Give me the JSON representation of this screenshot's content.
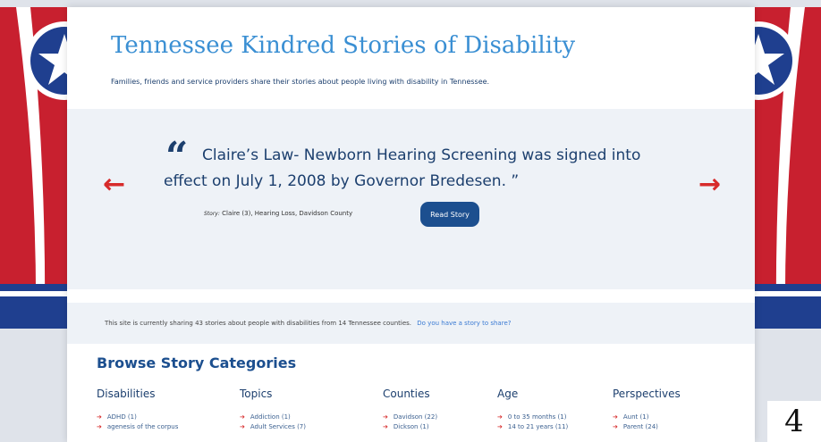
{
  "site": {
    "title": "Tennessee Kindred Stories of Disability",
    "tagline": "Families, friends and service providers share their stories about people living with disability in Tennessee."
  },
  "hero": {
    "quote_mark": "“",
    "quote": "Claire’s Law- Newborn Hearing Screening was signed into effect on July 1, 2008 by Governor Bredesen. ”",
    "story_label": "Story:",
    "story_meta": "Claire (3), Hearing Loss, Davidson County",
    "read_button": "Read Story",
    "prev_arrow": "←",
    "next_arrow": "→"
  },
  "info": {
    "text": "This site is currently sharing 43 stories about people with disabilities from 14 Tennessee counties.",
    "link": "Do you have a story to share?"
  },
  "browse": {
    "title": "Browse Story Categories",
    "columns": [
      {
        "heading": "Disabilities",
        "items": [
          "ADHD (1)",
          "agenesis of the corpus"
        ]
      },
      {
        "heading": "Topics",
        "items": [
          "Addiction (1)",
          "Adult Services (7)"
        ]
      },
      {
        "heading": "Counties",
        "items": [
          "Davidson (22)",
          "Dickson (1)"
        ]
      },
      {
        "heading": "Age",
        "items": [
          "0 to 35 months (1)",
          "14 to 21 years (11)"
        ]
      },
      {
        "heading": "Perspectives",
        "items": [
          "Aunt (1)",
          "Parent (24)"
        ]
      }
    ]
  },
  "page_number": "4",
  "colors": {
    "flag_red": "#c8202f",
    "flag_blue": "#1f3f8f",
    "title_blue": "#3a8fd3",
    "navy": "#1c3f6e",
    "arrow_red": "#d72b2b"
  },
  "icons": {
    "bullet": "➔"
  }
}
